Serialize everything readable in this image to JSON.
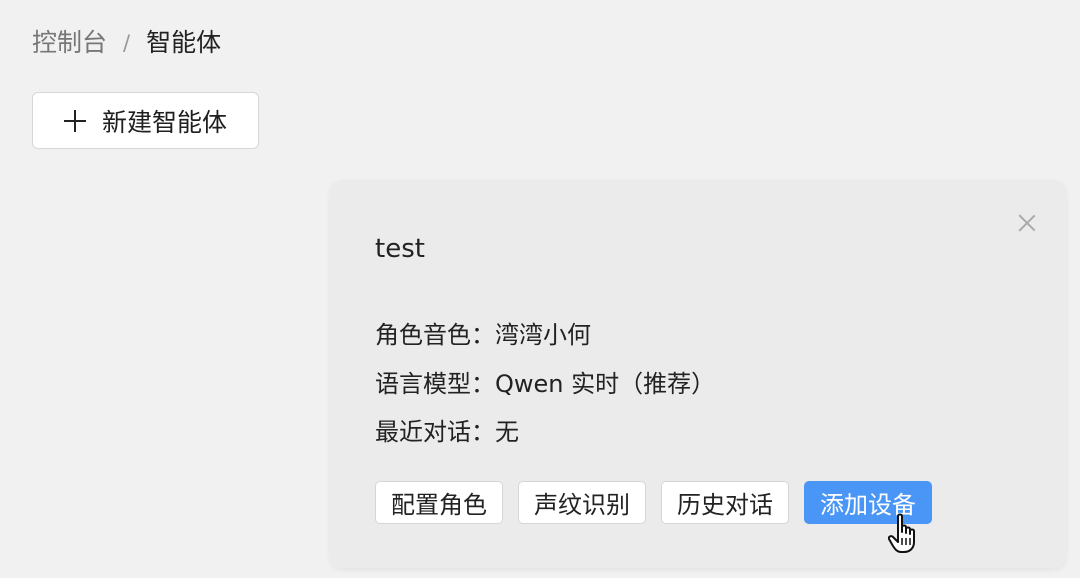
{
  "breadcrumb": {
    "home": "控制台",
    "separator": "/",
    "current": "智能体"
  },
  "toolbar": {
    "new_agent_label": "新建智能体",
    "new_agent_icon": "plus-icon"
  },
  "agent_card": {
    "name": "test",
    "close_icon": "close-icon",
    "voice_line": "角色音色：湾湾小何",
    "model_line": "语言模型：Qwen 实时（推荐）",
    "recent_line": "最近对话：无",
    "actions": {
      "configure_role": "配置角色",
      "voiceprint": "声纹识别",
      "history": "历史对话",
      "add_device": "添加设备"
    }
  },
  "colors": {
    "background": "#f1f1f1",
    "card_background": "#ebebeb",
    "primary": "#4a96f6"
  },
  "cursor": {
    "icon": "hand-pointer-icon"
  }
}
